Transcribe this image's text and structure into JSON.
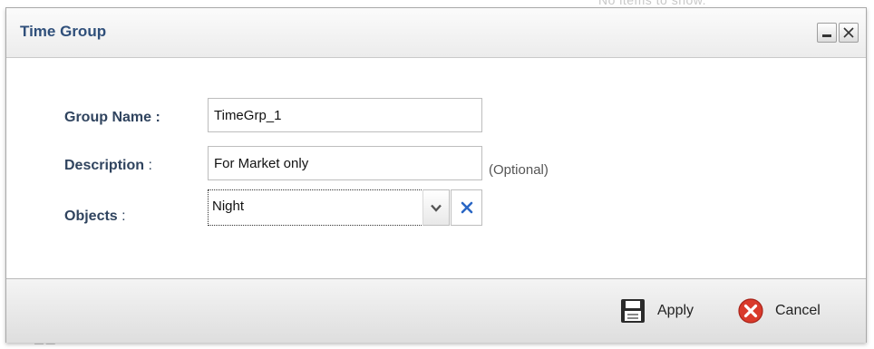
{
  "background": {
    "text": "No items to show."
  },
  "dialog": {
    "title": "Time Group",
    "minimize_label": "minimize",
    "close_label": "close"
  },
  "form": {
    "group_name": {
      "label": "Group Name",
      "colon": ":",
      "value": "TimeGrp_1"
    },
    "description": {
      "label": "Description",
      "colon": ":",
      "value": "For Market only",
      "hint": "(Optional)"
    },
    "objects": {
      "label": "Objects",
      "colon": ":",
      "value": "Night"
    }
  },
  "footer": {
    "apply_label": "Apply",
    "cancel_label": "Cancel"
  },
  "colors": {
    "label": "#30445f",
    "title": "#2f4f7a",
    "cancel_red": "#d93a2b",
    "clear_blue": "#2a66c4"
  },
  "icons": {
    "apply": "save-icon",
    "cancel": "cancel-icon",
    "dropdown": "chevron-down-icon",
    "clear": "clear-x-icon"
  }
}
